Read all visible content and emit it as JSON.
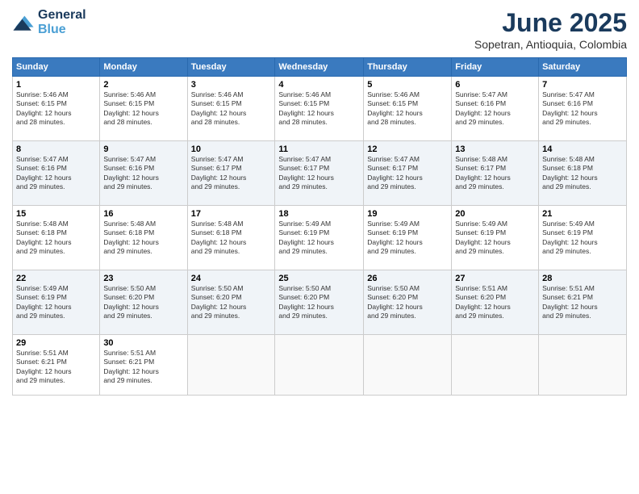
{
  "header": {
    "logo_general": "General",
    "logo_blue": "Blue",
    "month": "June 2025",
    "location": "Sopetran, Antioquia, Colombia"
  },
  "weekdays": [
    "Sunday",
    "Monday",
    "Tuesday",
    "Wednesday",
    "Thursday",
    "Friday",
    "Saturday"
  ],
  "weeks": [
    [
      {
        "day": "1",
        "sunrise": "5:46 AM",
        "sunset": "6:15 PM",
        "daylight": "12 hours and 28 minutes."
      },
      {
        "day": "2",
        "sunrise": "5:46 AM",
        "sunset": "6:15 PM",
        "daylight": "12 hours and 28 minutes."
      },
      {
        "day": "3",
        "sunrise": "5:46 AM",
        "sunset": "6:15 PM",
        "daylight": "12 hours and 28 minutes."
      },
      {
        "day": "4",
        "sunrise": "5:46 AM",
        "sunset": "6:15 PM",
        "daylight": "12 hours and 28 minutes."
      },
      {
        "day": "5",
        "sunrise": "5:46 AM",
        "sunset": "6:15 PM",
        "daylight": "12 hours and 28 minutes."
      },
      {
        "day": "6",
        "sunrise": "5:47 AM",
        "sunset": "6:16 PM",
        "daylight": "12 hours and 29 minutes."
      },
      {
        "day": "7",
        "sunrise": "5:47 AM",
        "sunset": "6:16 PM",
        "daylight": "12 hours and 29 minutes."
      }
    ],
    [
      {
        "day": "8",
        "sunrise": "5:47 AM",
        "sunset": "6:16 PM",
        "daylight": "12 hours and 29 minutes."
      },
      {
        "day": "9",
        "sunrise": "5:47 AM",
        "sunset": "6:16 PM",
        "daylight": "12 hours and 29 minutes."
      },
      {
        "day": "10",
        "sunrise": "5:47 AM",
        "sunset": "6:17 PM",
        "daylight": "12 hours and 29 minutes."
      },
      {
        "day": "11",
        "sunrise": "5:47 AM",
        "sunset": "6:17 PM",
        "daylight": "12 hours and 29 minutes."
      },
      {
        "day": "12",
        "sunrise": "5:47 AM",
        "sunset": "6:17 PM",
        "daylight": "12 hours and 29 minutes."
      },
      {
        "day": "13",
        "sunrise": "5:48 AM",
        "sunset": "6:17 PM",
        "daylight": "12 hours and 29 minutes."
      },
      {
        "day": "14",
        "sunrise": "5:48 AM",
        "sunset": "6:18 PM",
        "daylight": "12 hours and 29 minutes."
      }
    ],
    [
      {
        "day": "15",
        "sunrise": "5:48 AM",
        "sunset": "6:18 PM",
        "daylight": "12 hours and 29 minutes."
      },
      {
        "day": "16",
        "sunrise": "5:48 AM",
        "sunset": "6:18 PM",
        "daylight": "12 hours and 29 minutes."
      },
      {
        "day": "17",
        "sunrise": "5:48 AM",
        "sunset": "6:18 PM",
        "daylight": "12 hours and 29 minutes."
      },
      {
        "day": "18",
        "sunrise": "5:49 AM",
        "sunset": "6:19 PM",
        "daylight": "12 hours and 29 minutes."
      },
      {
        "day": "19",
        "sunrise": "5:49 AM",
        "sunset": "6:19 PM",
        "daylight": "12 hours and 29 minutes."
      },
      {
        "day": "20",
        "sunrise": "5:49 AM",
        "sunset": "6:19 PM",
        "daylight": "12 hours and 29 minutes."
      },
      {
        "day": "21",
        "sunrise": "5:49 AM",
        "sunset": "6:19 PM",
        "daylight": "12 hours and 29 minutes."
      }
    ],
    [
      {
        "day": "22",
        "sunrise": "5:49 AM",
        "sunset": "6:19 PM",
        "daylight": "12 hours and 29 minutes."
      },
      {
        "day": "23",
        "sunrise": "5:50 AM",
        "sunset": "6:20 PM",
        "daylight": "12 hours and 29 minutes."
      },
      {
        "day": "24",
        "sunrise": "5:50 AM",
        "sunset": "6:20 PM",
        "daylight": "12 hours and 29 minutes."
      },
      {
        "day": "25",
        "sunrise": "5:50 AM",
        "sunset": "6:20 PM",
        "daylight": "12 hours and 29 minutes."
      },
      {
        "day": "26",
        "sunrise": "5:50 AM",
        "sunset": "6:20 PM",
        "daylight": "12 hours and 29 minutes."
      },
      {
        "day": "27",
        "sunrise": "5:51 AM",
        "sunset": "6:20 PM",
        "daylight": "12 hours and 29 minutes."
      },
      {
        "day": "28",
        "sunrise": "5:51 AM",
        "sunset": "6:21 PM",
        "daylight": "12 hours and 29 minutes."
      }
    ],
    [
      {
        "day": "29",
        "sunrise": "5:51 AM",
        "sunset": "6:21 PM",
        "daylight": "12 hours and 29 minutes."
      },
      {
        "day": "30",
        "sunrise": "5:51 AM",
        "sunset": "6:21 PM",
        "daylight": "12 hours and 29 minutes."
      },
      null,
      null,
      null,
      null,
      null
    ]
  ],
  "labels": {
    "sunrise": "Sunrise:",
    "sunset": "Sunset:",
    "daylight": "Daylight:"
  }
}
